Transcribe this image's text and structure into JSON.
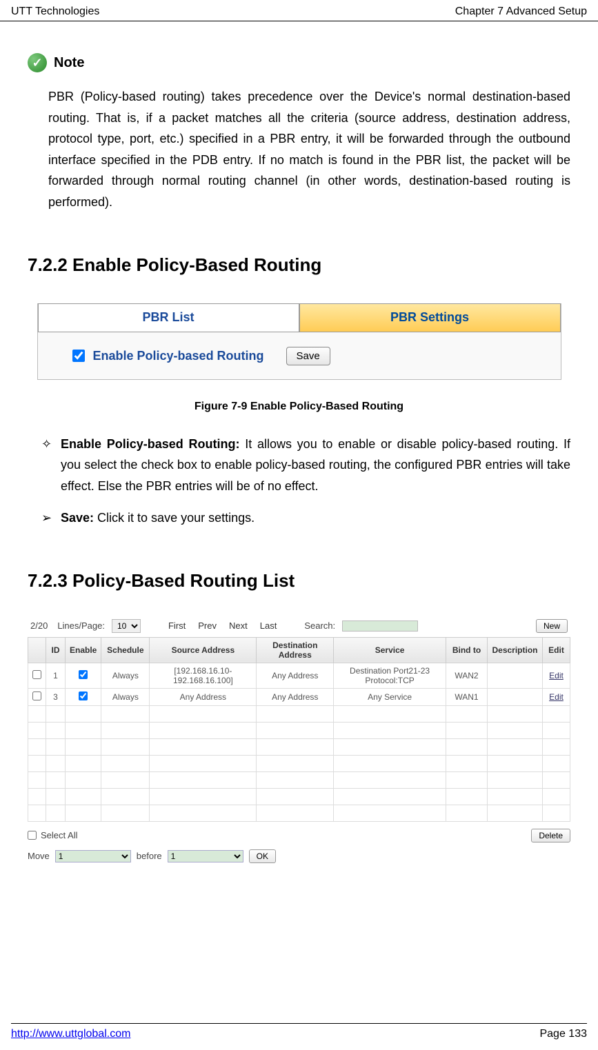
{
  "header": {
    "left": "UTT Technologies",
    "right": "Chapter 7 Advanced Setup"
  },
  "note": {
    "label": "Note",
    "body": "PBR (Policy-based routing) takes precedence over the Device's normal destination-based routing. That is, if a packet matches all the criteria (source address, destination address, protocol type, port, etc.) specified in a PBR entry, it will be forwarded through the outbound interface specified in the PDB entry. If no match is found in the PBR list, the packet will be forwarded through normal routing channel (in other words, destination-based routing is performed)."
  },
  "section722": {
    "heading": "7.2.2    Enable Policy-Based Routing",
    "tab1": "PBR List",
    "tab2": "PBR Settings",
    "checkbox_label": "Enable Policy-based Routing",
    "save": "Save",
    "caption": "Figure 7-9 Enable Policy-Based Routing"
  },
  "bullets": {
    "b1_bold": "Enable Policy-based Routing:",
    "b1_rest": " It allows you to enable or disable policy-based routing. If you select the check box to enable policy-based routing, the configured PBR entries will take effect. Else the PBR entries will be of no effect.",
    "b2_bold": "Save:",
    "b2_rest": " Click it to save your settings."
  },
  "section723": {
    "heading": "7.2.3    Policy-Based Routing List"
  },
  "list": {
    "count": "2/20",
    "lines_label": "Lines/Page:",
    "lines_value": "10",
    "nav": {
      "first": "First",
      "prev": "Prev",
      "next": "Next",
      "last": "Last"
    },
    "search_label": "Search:",
    "new_btn": "New",
    "columns": [
      "",
      "ID",
      "Enable",
      "Schedule",
      "Source Address",
      "Destination Address",
      "Service",
      "Bind to",
      "Description",
      "Edit"
    ],
    "rows": [
      {
        "id": "1",
        "enable": true,
        "schedule": "Always",
        "src": "[192.168.16.10-192.168.16.100]",
        "dst": "Any Address",
        "service": "Destination Port21-23 Protocol:TCP",
        "bind": "WAN2",
        "desc": "",
        "edit": "Edit"
      },
      {
        "id": "3",
        "enable": true,
        "schedule": "Always",
        "src": "Any Address",
        "dst": "Any Address",
        "service": "Any Service",
        "bind": "WAN1",
        "desc": "",
        "edit": "Edit"
      }
    ],
    "select_all": "Select All",
    "delete_btn": "Delete",
    "move_label": "Move",
    "before_label": "before",
    "ok_btn": "OK"
  },
  "footer": {
    "url": "http://www.uttglobal.com",
    "page": "Page 133"
  }
}
